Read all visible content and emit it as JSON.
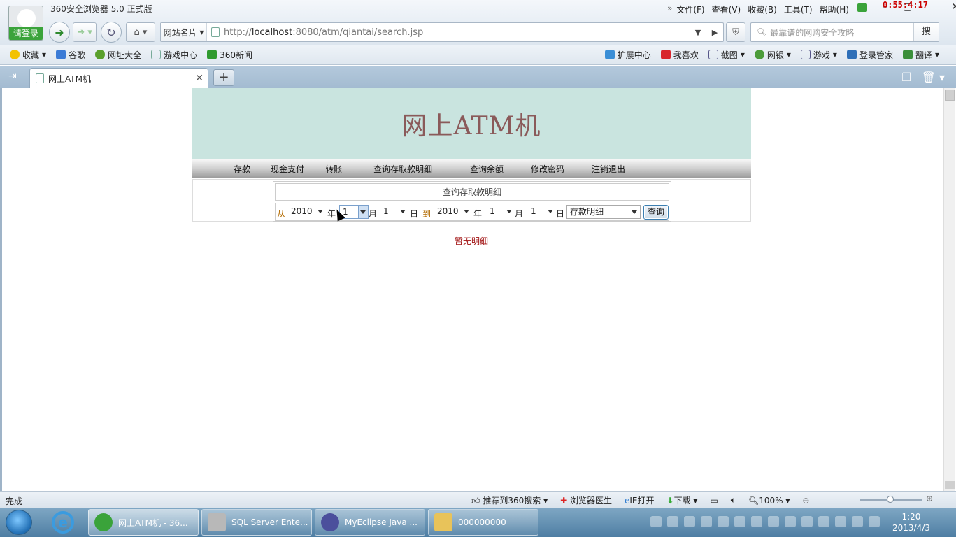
{
  "browser": {
    "app_title": "360安全浏览器 5.0 正式版",
    "login_label": "请登录",
    "menus": [
      "文件(F)",
      "查看(V)",
      "收藏(B)",
      "工具(T)",
      "帮助(H)"
    ],
    "timer": "0:55:4:17",
    "site_card": "网站名片",
    "url_prefix": "http://",
    "url_host": "localhost",
    "url_rest": ":8080/atm/qiantai/search.jsp",
    "search_placeholder": "最靠谱的网购安全攻略",
    "search_button": "搜",
    "bookmarks_left": [
      "收藏",
      "谷歌",
      "网址大全",
      "游戏中心",
      "360新闻"
    ],
    "bookmarks_right": [
      "扩展中心",
      "我喜欢",
      "截图",
      "网银",
      "游戏",
      "登录管家",
      "翻译"
    ],
    "tab_title": "网上ATM机",
    "status_text": "完成",
    "status_items": [
      "推荐到360搜索",
      "浏览器医生",
      "IE打开",
      "下载"
    ],
    "zoom": "100%"
  },
  "page": {
    "title": "网上ATM机",
    "nav": [
      "存款",
      "现金支付",
      "转账",
      "查询存取款明细",
      "查询余额",
      "修改密码",
      "注销退出"
    ],
    "form_caption": "查询存取款明细",
    "from_label": "从",
    "to_label": "到",
    "year_label": "年",
    "month_label": "月",
    "day_label": "日",
    "from_year": "2010",
    "from_month": "1",
    "from_day": "1",
    "to_year": "2010",
    "to_month": "1",
    "to_day": "1",
    "type_value": "存款明细",
    "query_button": "查询",
    "empty_message": "暂无明细"
  },
  "taskbar": {
    "items": [
      "网上ATM机 - 36...",
      "SQL Server Ente...",
      "MyEclipse Java ...",
      "000000000"
    ],
    "time": "1:20",
    "date": "2013/4/3"
  },
  "colors": {
    "banner_bg": "#c9e4df",
    "title_color": "#8a5a5a",
    "empty_message": "#a01010"
  }
}
